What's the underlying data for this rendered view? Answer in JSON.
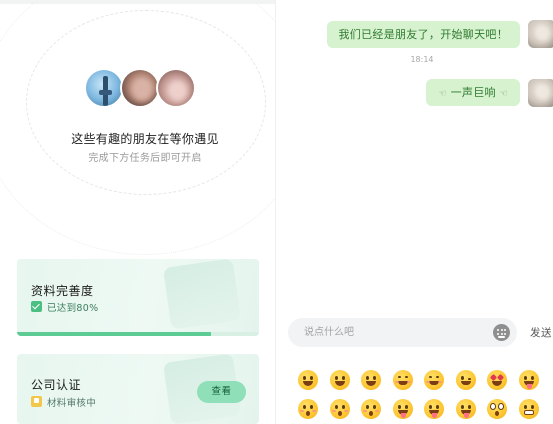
{
  "discover": {
    "title": "这些有趣的朋友在等你遇见",
    "subtitle": "完成下方任务后即可开启"
  },
  "tasks": {
    "profile": {
      "title": "资料完善度",
      "status": "已达到80%",
      "progress": 0.8
    },
    "company": {
      "title": "公司认证",
      "status": "材料审核中",
      "button": "查看"
    }
  },
  "chat": {
    "messages": [
      {
        "text": "我们已经是朋友了，开始聊天吧！"
      },
      {
        "fist_left": "☜",
        "text": "一声巨响",
        "fist_right": "☜"
      }
    ],
    "timestamp": "18:14"
  },
  "composer": {
    "placeholder": "说点什么吧",
    "send_label": "发送"
  },
  "emoji_panel": {
    "items": [
      "grinning",
      "grinning-big",
      "smile",
      "blush-smile",
      "relaxed",
      "wink",
      "heart-eyes",
      "tongue-wink",
      "kissing-closed-eyes",
      "kissing",
      "kissing-smiling",
      "stuck-out-tongue-wink",
      "squinting-tongue",
      "stuck-out-tongue",
      "flushed",
      "grimacing"
    ]
  },
  "colors": {
    "accent": "#5ccb94",
    "bubble": "#d6f2cf",
    "bubble_text": "#2f7a2f",
    "card_bg": "#e7f6ef"
  }
}
